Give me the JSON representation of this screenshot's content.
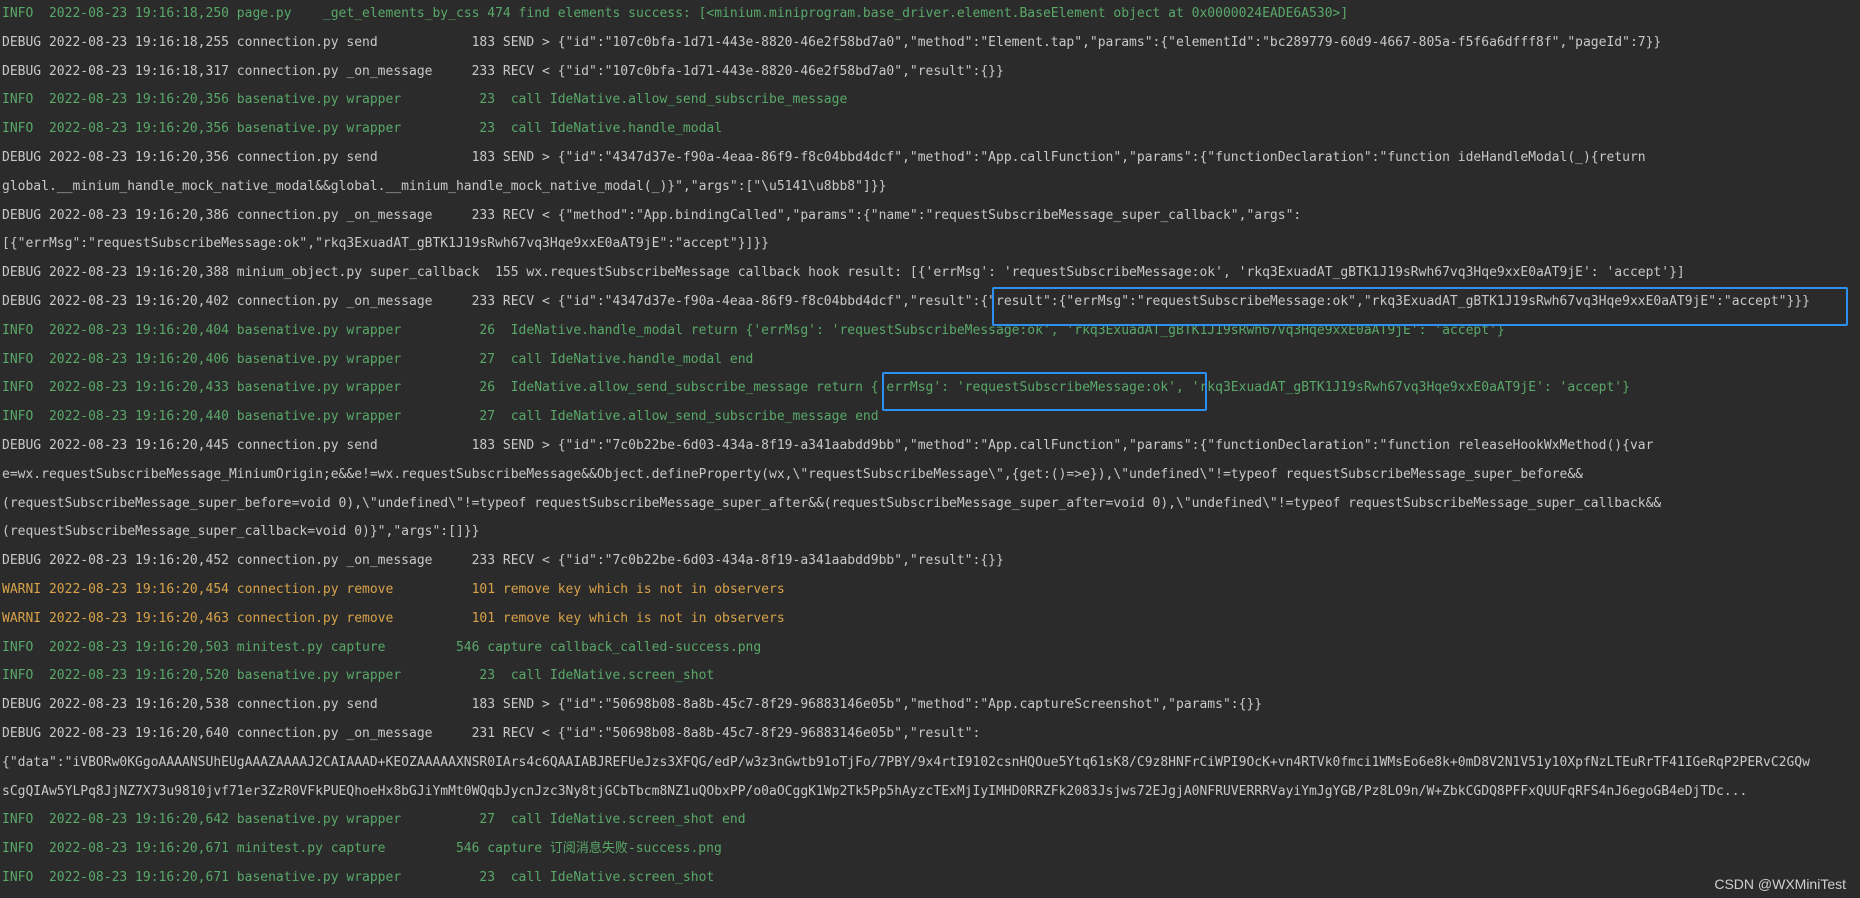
{
  "log_lines": [
    {
      "level": "INFO",
      "text": "INFO  2022-08-23 19:16:18,250 page.py    _get_elements_by_css 474 find elements success: [<minium.miniprogram.base_driver.element.BaseElement object at 0x0000024EADE6A530>]"
    },
    {
      "level": "DEBUG",
      "text": "DEBUG 2022-08-23 19:16:18,255 connection.py send            183 SEND > {\"id\":\"107c0bfa-1d71-443e-8820-46e2f58bd7a0\",\"method\":\"Element.tap\",\"params\":{\"elementId\":\"bc289779-60d9-4667-805a-f5f6a6dfff8f\",\"pageId\":7}}"
    },
    {
      "level": "DEBUG",
      "text": "DEBUG 2022-08-23 19:16:18,317 connection.py _on_message     233 RECV < {\"id\":\"107c0bfa-1d71-443e-8820-46e2f58bd7a0\",\"result\":{}}"
    },
    {
      "level": "INFO",
      "text": "INFO  2022-08-23 19:16:20,356 basenative.py wrapper          23  call IdeNative.allow_send_subscribe_message"
    },
    {
      "level": "INFO",
      "text": "INFO  2022-08-23 19:16:20,356 basenative.py wrapper          23  call IdeNative.handle_modal"
    },
    {
      "level": "DEBUG",
      "text": "DEBUG 2022-08-23 19:16:20,356 connection.py send            183 SEND > {\"id\":\"4347d37e-f90a-4eaa-86f9-f8c04bbd4dcf\",\"method\":\"App.callFunction\",\"params\":{\"functionDeclaration\":\"function ideHandleModal(_){return"
    },
    {
      "level": "CONT",
      "text": "global.__minium_handle_mock_native_modal&&global.__minium_handle_mock_native_modal(_)}\",\"args\":[\"\\u5141\\u8bb8\"]}}"
    },
    {
      "level": "DEBUG",
      "text": "DEBUG 2022-08-23 19:16:20,386 connection.py _on_message     233 RECV < {\"method\":\"App.bindingCalled\",\"params\":{\"name\":\"requestSubscribeMessage_super_callback\",\"args\":"
    },
    {
      "level": "CONT",
      "text": "[{\"errMsg\":\"requestSubscribeMessage:ok\",\"rkq3ExuadAT_gBTK1J19sRwh67vq3Hqe9xxE0aAT9jE\":\"accept\"}]}}"
    },
    {
      "level": "DEBUG",
      "text": "DEBUG 2022-08-23 19:16:20,388 minium_object.py super_callback  155 wx.requestSubscribeMessage callback hook result: [{'errMsg': 'requestSubscribeMessage:ok', 'rkq3ExuadAT_gBTK1J19sRwh67vq3Hqe9xxE0aAT9jE': 'accept'}]"
    },
    {
      "level": "DEBUG",
      "text": "DEBUG 2022-08-23 19:16:20,402 connection.py _on_message     233 RECV < {\"id\":\"4347d37e-f90a-4eaa-86f9-f8c04bbd4dcf\",\"result\":{\"result\":{\"errMsg\":\"requestSubscribeMessage:ok\",\"rkq3ExuadAT_gBTK1J19sRwh67vq3Hqe9xxE0aAT9jE\":\"accept\"}}}"
    },
    {
      "level": "INFO",
      "text": "INFO  2022-08-23 19:16:20,404 basenative.py wrapper          26  IdeNative.handle_modal return {'errMsg': 'requestSubscribeMessage:ok', 'rkq3ExuadAT_gBTK1J19sRwh67vq3Hqe9xxE0aAT9jE': 'accept'}"
    },
    {
      "level": "INFO",
      "text": "INFO  2022-08-23 19:16:20,406 basenative.py wrapper          27  call IdeNative.handle_modal end"
    },
    {
      "level": "INFO",
      "text": "INFO  2022-08-23 19:16:20,433 basenative.py wrapper          26  IdeNative.allow_send_subscribe_message return {'errMsg': 'requestSubscribeMessage:ok', 'rkq3ExuadAT_gBTK1J19sRwh67vq3Hqe9xxE0aAT9jE': 'accept'}"
    },
    {
      "level": "INFO",
      "text": "INFO  2022-08-23 19:16:20,440 basenative.py wrapper          27  call IdeNative.allow_send_subscribe_message end"
    },
    {
      "level": "DEBUG",
      "text": "DEBUG 2022-08-23 19:16:20,445 connection.py send            183 SEND > {\"id\":\"7c0b22be-6d03-434a-8f19-a341aabdd9bb\",\"method\":\"App.callFunction\",\"params\":{\"functionDeclaration\":\"function releaseHookWxMethod(){var"
    },
    {
      "level": "CONT",
      "text": "e=wx.requestSubscribeMessage_MiniumOrigin;e&&e!=wx.requestSubscribeMessage&&Object.defineProperty(wx,\\\"requestSubscribeMessage\\\",{get:()=>e}),\\\"undefined\\\"!=typeof requestSubscribeMessage_super_before&&"
    },
    {
      "level": "CONT",
      "text": "(requestSubscribeMessage_super_before=void 0),\\\"undefined\\\"!=typeof requestSubscribeMessage_super_after&&(requestSubscribeMessage_super_after=void 0),\\\"undefined\\\"!=typeof requestSubscribeMessage_super_callback&&"
    },
    {
      "level": "CONT",
      "text": "(requestSubscribeMessage_super_callback=void 0)}\",\"args\":[]}}"
    },
    {
      "level": "DEBUG",
      "text": "DEBUG 2022-08-23 19:16:20,452 connection.py _on_message     233 RECV < {\"id\":\"7c0b22be-6d03-434a-8f19-a341aabdd9bb\",\"result\":{}}"
    },
    {
      "level": "WARNI",
      "text": "WARNI 2022-08-23 19:16:20,454 connection.py remove          101 remove key which is not in observers"
    },
    {
      "level": "WARNI",
      "text": "WARNI 2022-08-23 19:16:20,463 connection.py remove          101 remove key which is not in observers"
    },
    {
      "level": "INFO",
      "text": "INFO  2022-08-23 19:16:20,503 minitest.py capture         546 capture callback_called-success.png"
    },
    {
      "level": "INFO",
      "text": "INFO  2022-08-23 19:16:20,520 basenative.py wrapper          23  call IdeNative.screen_shot"
    },
    {
      "level": "DEBUG",
      "text": "DEBUG 2022-08-23 19:16:20,538 connection.py send            183 SEND > {\"id\":\"50698b08-8a8b-45c7-8f29-96883146e05b\",\"method\":\"App.captureScreenshot\",\"params\":{}}"
    },
    {
      "level": "DEBUG",
      "text": "DEBUG 2022-08-23 19:16:20,640 connection.py _on_message     231 RECV < {\"id\":\"50698b08-8a8b-45c7-8f29-96883146e05b\",\"result\":"
    },
    {
      "level": "CONT",
      "text": "{\"data\":\"iVBORw0KGgoAAAANSUhEUgAAAZAAAAJ2CAIAAAD+KEOZAAAAAXNSR0IArs4c6QAAIABJREFUeJzs3XFQG/edP/w3z3nGwtb91oTjFo/7PBY/9x4rtI9102csnHQOue5Ytq61sK8/C9z8HNFrCiWPI9OcK+vn4RTVk0fmci1WMsEo6e8k+0mD8V2N1V51y10XpfNzLTEuRrTF41IGeRqP2PERvC2GQw"
    },
    {
      "level": "CONT",
      "text": "sCgQIAw5YLPq8JjNZ7X73u9810jvf71er3ZzR0VFkPUEQhoeHx8bGJiYmMt0WQqbJycnJzc3Ny8tjGCbTbcm8NZ1uQObxPP/o0aOCggK1Wp2Tk5Pp5hAyzcTExMjIyIMHD0RRZFk2083Jsjws72EJgjA0NFRUVERRRVayiYmJgYGB/Pz8LO9n/W+ZbkCGDQ8PFFxQUUFqRFS4nJ6egoGB4eDjTDc..."
    },
    {
      "level": "INFO",
      "text": "INFO  2022-08-23 19:16:20,642 basenative.py wrapper          27  call IdeNative.screen_shot end"
    },
    {
      "level": "INFO",
      "text": "INFO  2022-08-23 19:16:20,671 minitest.py capture         546 capture 订阅消息失败-success.png"
    },
    {
      "level": "INFO",
      "text": "INFO  2022-08-23 19:16:20,671 basenative.py wrapper          23  call IdeNative.screen_shot"
    }
  ],
  "watermark": "CSDN @WXMiniTest"
}
